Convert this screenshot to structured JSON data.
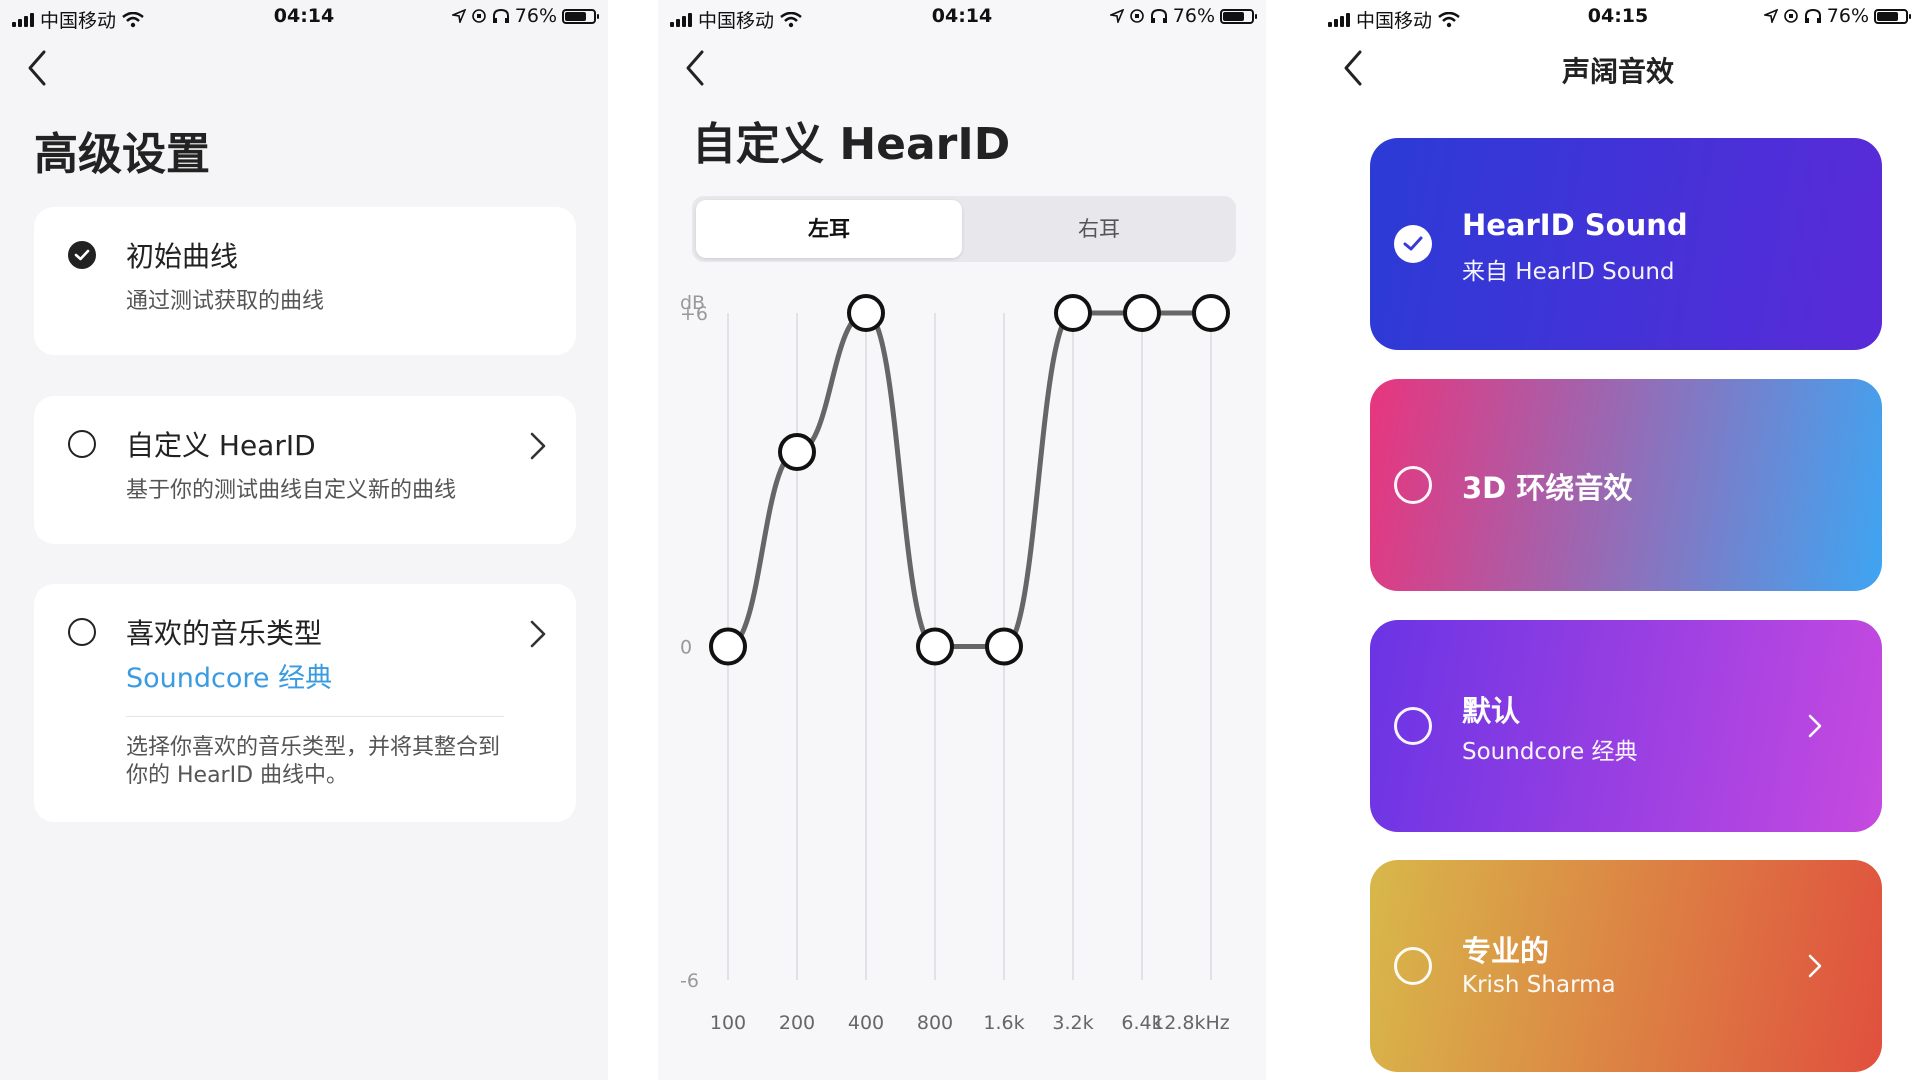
{
  "status_bar": {
    "carrier": "中国移动",
    "battery": "76%",
    "battery_level": 0.76
  },
  "panel1": {
    "time": "04:14",
    "title": "高级设置",
    "cards": [
      {
        "title": "初始曲线",
        "subtitle": "通过测试获取的曲线",
        "selected": true
      },
      {
        "title": "自定义 HearID",
        "subtitle": "基于你的测试曲线自定义新的曲线",
        "selected": false
      },
      {
        "title": "喜欢的音乐类型",
        "subtitle": "Soundcore 经典",
        "description": "选择你喜欢的音乐类型，并将其整合到你的 HearID 曲线中。",
        "selected": false
      }
    ]
  },
  "panel2": {
    "time": "04:14",
    "title": "自定义 HearID",
    "tabs": [
      {
        "label": "左耳",
        "active": true
      },
      {
        "label": "右耳",
        "active": false
      }
    ],
    "chart_data": {
      "type": "line",
      "x": [
        "100",
        "200",
        "400",
        "800",
        "1.6k",
        "3.2k",
        "6.4k",
        "12.8kHz"
      ],
      "values": [
        0,
        3.5,
        6,
        0,
        0,
        6,
        6,
        6
      ],
      "ylabel": "dB",
      "y_tick_labels": [
        "+6",
        "0",
        "-6"
      ],
      "ylim": [
        -6,
        6
      ],
      "grid": true,
      "line_color": "#666666"
    }
  },
  "panel3": {
    "time": "04:15",
    "title": "声阔音效",
    "effects": [
      {
        "title": "HearID Sound",
        "subtitle": "来自 HearID Sound",
        "selected": true,
        "has_chevron": false,
        "colors": [
          "#2b3bd6",
          "#5a2ad8"
        ]
      },
      {
        "title": "3D 环绕音效",
        "subtitle": "",
        "selected": false,
        "has_chevron": false,
        "colors": [
          "#e8357d",
          "#3ea5f2"
        ]
      },
      {
        "title": "默认",
        "subtitle": "Soundcore 经典",
        "selected": false,
        "has_chevron": true,
        "colors": [
          "#6a34e4",
          "#c64ae0"
        ]
      },
      {
        "title": "专业的",
        "subtitle": "Krish Sharma",
        "selected": false,
        "has_chevron": true,
        "colors": [
          "#d8b84a",
          "#e0503e"
        ]
      }
    ]
  }
}
